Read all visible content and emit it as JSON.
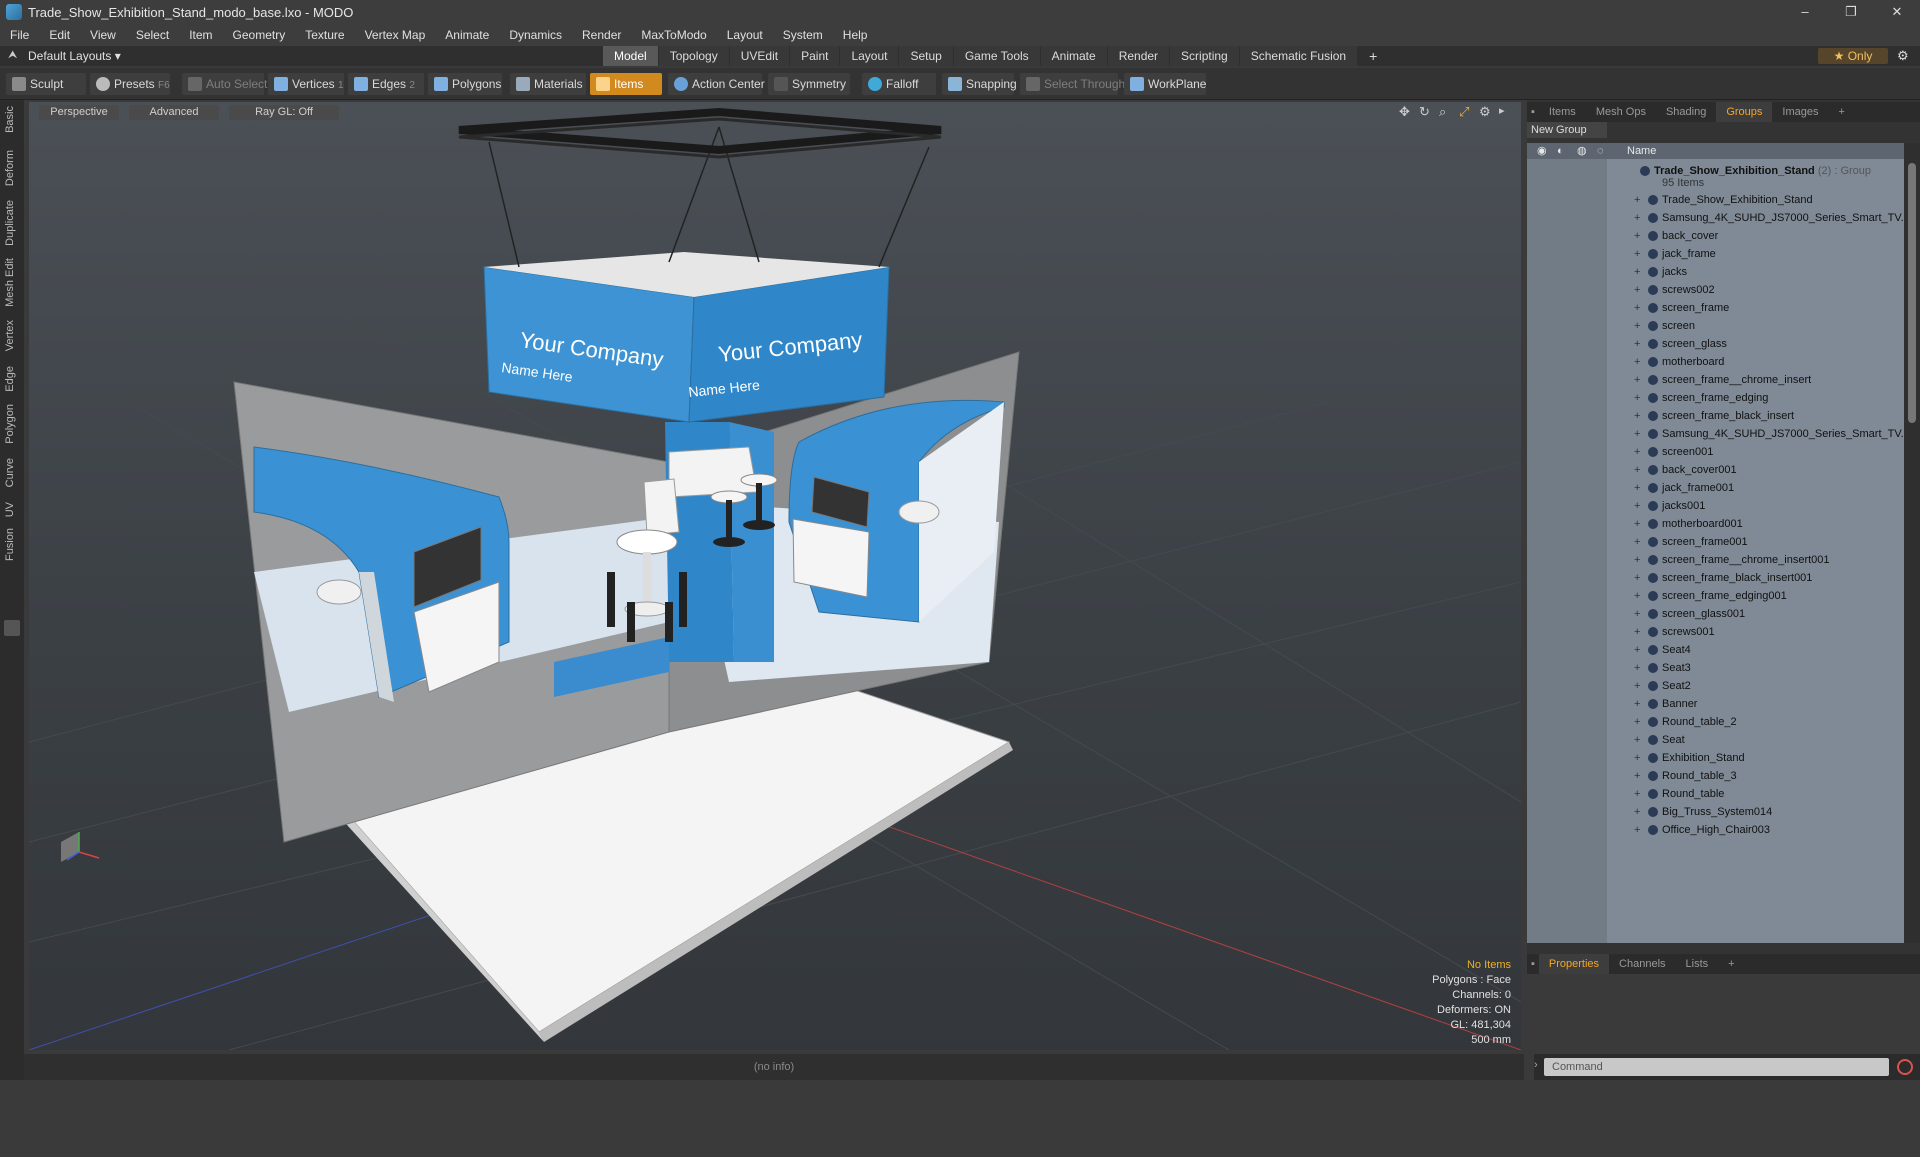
{
  "window": {
    "title": "Trade_Show_Exhibition_Stand_modo_base.lxo - MODO",
    "controls": [
      "–",
      "❐",
      "✕"
    ]
  },
  "menu": [
    "File",
    "Edit",
    "View",
    "Select",
    "Item",
    "Geometry",
    "Texture",
    "Vertex Map",
    "Animate",
    "Dynamics",
    "Render",
    "MaxToModo",
    "Layout",
    "System",
    "Help"
  ],
  "layout": {
    "name": "Default Layouts",
    "tabs": [
      "Model",
      "Topology",
      "UVEdit",
      "Paint",
      "Layout",
      "Setup",
      "Game Tools",
      "Animate",
      "Render",
      "Scripting",
      "Schematic Fusion"
    ],
    "active": "Model",
    "only": "Only"
  },
  "toolbar": {
    "sculpt": "Sculpt",
    "presets": "Presets",
    "presets_key": "F6",
    "auto_select": "Auto Select",
    "vertices": "Vertices",
    "vertices_key": "1",
    "edges": "Edges",
    "edges_key": "2",
    "polygons": "Polygons",
    "materials": "Materials",
    "items": "Items",
    "action_center": "Action Center",
    "symmetry": "Symmetry",
    "falloff": "Falloff",
    "snapping": "Snapping",
    "select_through": "Select Through",
    "workplane": "WorkPlane"
  },
  "left_tabs": [
    "Basic",
    "Deform",
    "Duplicate",
    "Mesh Edit",
    "Vertex",
    "Edge",
    "Polygon",
    "Curve",
    "UV",
    "Fusion"
  ],
  "viewport": {
    "view": "Perspective",
    "shading": "Advanced",
    "raygl": "Ray GL: Off",
    "info": {
      "selection": "No Items",
      "polygons": "Polygons : Face",
      "channels": "Channels: 0",
      "deformers": "Deformers: ON",
      "gl": "GL: 481,304",
      "scale": "500 mm"
    },
    "banner": {
      "company": "Your Company",
      "name": "Name Here"
    }
  },
  "bottom_info": "(no info)",
  "panel_tabs": [
    "Items",
    "Mesh Ops",
    "Shading",
    "Groups",
    "Images"
  ],
  "panel_active": "Groups",
  "groups": {
    "new_group": "New Group",
    "col_name": "Name",
    "root": {
      "name": "Trade_Show_Exhibition_Stand",
      "suffix": "(2) : Group",
      "count": "95 Items"
    },
    "items": [
      "Trade_Show_Exhibition_Stand",
      "Samsung_4K_SUHD_JS7000_Series_Smart_TV...",
      "back_cover",
      "jack_frame",
      "jacks",
      "screws002",
      "screen_frame",
      "screen",
      "screen_glass",
      "motherboard",
      "screen_frame__chrome_insert",
      "screen_frame_edging",
      "screen_frame_black_insert",
      "Samsung_4K_SUHD_JS7000_Series_Smart_TV...",
      "screen001",
      "back_cover001",
      "jack_frame001",
      "jacks001",
      "motherboard001",
      "screen_frame001",
      "screen_frame__chrome_insert001",
      "screen_frame_black_insert001",
      "screen_frame_edging001",
      "screen_glass001",
      "screws001",
      "Seat4",
      "Seat3",
      "Seat2",
      "Banner",
      "Round_table_2",
      "Seat",
      "Exhibition_Stand",
      "Round_table_3",
      "Round_table",
      "Big_Truss_System014",
      "Office_High_Chair003"
    ]
  },
  "props_tabs": [
    "Properties",
    "Channels",
    "Lists"
  ],
  "props_active": "Properties",
  "command_placeholder": "Command"
}
